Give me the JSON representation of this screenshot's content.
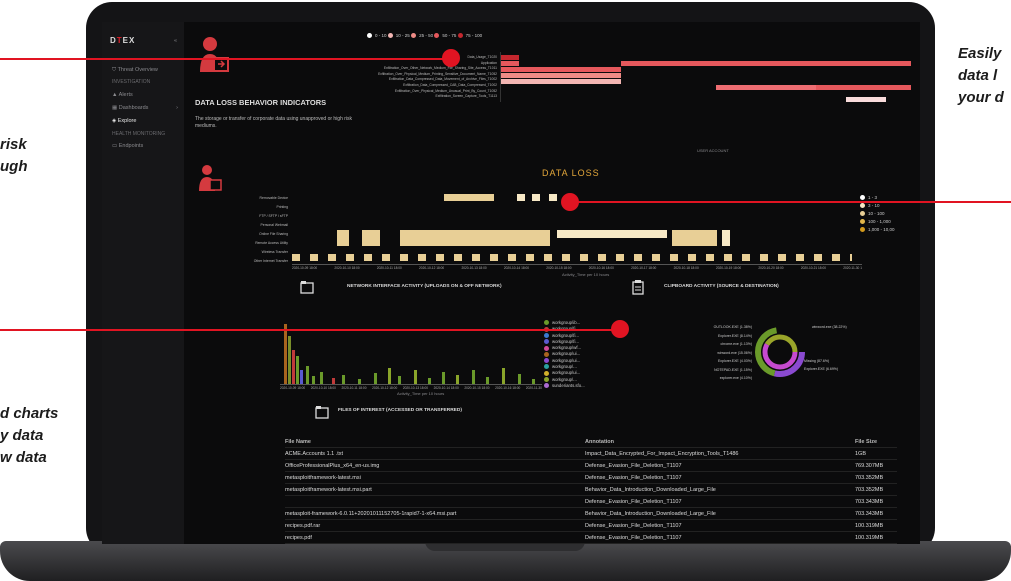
{
  "callouts": {
    "top_right": [
      "Easily",
      "data l",
      "your d"
    ],
    "mid_left": [
      "risk",
      "ugh"
    ],
    "bottom_left": [
      "d charts",
      "y data",
      "w data"
    ]
  },
  "sidebar": {
    "logo_pre": "D",
    "logo_accent": "T",
    "logo_post": "EX",
    "collapse": "«",
    "items": [
      {
        "label": "Threat Overview",
        "icon": "shield-icon"
      },
      {
        "label": "Alerts",
        "icon": "warning-icon"
      },
      {
        "label": "Dashboards",
        "icon": "grid-icon",
        "chevron": "›"
      },
      {
        "label": "Explore",
        "icon": "explore-icon"
      },
      {
        "label": "Endpoints",
        "icon": "monitor-icon"
      }
    ],
    "headers": [
      "INVESTIGATION",
      "HEALTH MONITORING"
    ]
  },
  "behavior": {
    "title": "DATA LOSS BEHAVIOR INDICATORS",
    "description": "The storage or transfer of corporate data using unapproved or high risk mediums.",
    "legend": [
      "0 - 10",
      "10 - 25",
      "25 - 50",
      "50 - 75",
      "75 - 100"
    ],
    "legend_colors": [
      "#ffffff",
      "#f3b6b3",
      "#ee8b86",
      "#e5585c",
      "#c4272e"
    ],
    "row_labels": [
      "Data_Usage_T1020",
      "Application",
      "Exfiltration_Over_Other_Network_Medium_File_Sharing_Site_Access_T1011",
      "Exfiltration_Over_Physical_Medium_Printing_Sensitive_Document_Name_T1052",
      "Exfiltration_Data_Compressed_Data_Movement_of_Archive_Files_T1002",
      "Exfiltration_Data_Compressed_CAB_Data_Compressed_T1002",
      "Exfiltration_Over_Physical_Medium_Unusual_Print_By_Count_T1052",
      "Exfiltration_Screen_Capture_Tools_T1113"
    ],
    "y_axis_label": "DATA LOSS BEHAVIOR INDICATORS",
    "x_axis_label": "USER ACCOUNT"
  },
  "dataloss": {
    "title": "DATA LOSS",
    "row_labels": [
      "Removable Device",
      "Printing",
      "FTP / SFTP / sFTP",
      "Personal Webmail",
      "Online File Sharing",
      "Remote Access Utility",
      "Wireless Transfer",
      "Other Internet Transfer"
    ],
    "x_ticks": [
      "2020-10-09 18:00",
      "2020-10-10 18:00",
      "2020-10-11 18:00",
      "2020-10-12 18:00",
      "2020-10-13 18:00",
      "2020-10-14 18:00",
      "2020-10-15 18:00",
      "2020-10-16 18:00",
      "2020-10-17 18:00",
      "2020-10-18 18:00",
      "2020-10-19 18:00",
      "2020-10-20 18:00",
      "2020-10-21 18:00",
      "2020-11-30 1"
    ],
    "x_label": "Activity_Time per 10 hours",
    "y_label": "Class",
    "legend": [
      "1 - 3",
      "3 - 10",
      "10 - 100",
      "100 - 1,000",
      "1,000 - 10,00"
    ]
  },
  "network": {
    "title": "NETWORK INTERFACE ACTIVITY (UPLOADS ON & OFF NETWORK)",
    "x_ticks": [
      "2020-10-09 18:00",
      "2020-10-10 18:00",
      "2020-10-11 18:00",
      "2020-10-12 18:00",
      "2020-10-13 18:00",
      "2020-10-14 18:00",
      "2020-10-15 18:00",
      "2020-10-16 18:00",
      "2020-11-30"
    ],
    "x_label": "Activity_Time per 10 hours",
    "legend": [
      "workgroup\\ib...",
      "workgroup\\fi...",
      "workgroup\\fi...",
      "workgroup\\fi...",
      "workgroup\\wf...",
      "workgroup\\ui...",
      "workgroup\\ui...",
      "workgroup\\...",
      "workgroup\\ui...",
      "workgroup\\...",
      "sunderiants.sfo..."
    ]
  },
  "clipboard": {
    "title": "CLIPBOARD ACTIVITY (SOURCE & DESTINATION)",
    "left_labels": [
      "OUTLOOK.EXE (1.38%)",
      "Explorer.EXE (8.14%)",
      "chrome.exe (1.13%)",
      "winword.exe (15.06%)",
      "Explorer.EXE (4.03%)",
      "NOTEPAD.EXE (1.15%)",
      "explorer.exe (4.10%)"
    ],
    "right_labels": [
      "winword.exe (38.22%)",
      "Missing (87.6%)",
      "Explorer.EXE (6.69%)"
    ]
  },
  "files": {
    "title": "FILES OF INTEREST (ACCESSED OR TRANSFERRED)",
    "headers": [
      "File Name",
      "Annotation",
      "File Size"
    ],
    "rows": [
      [
        "ACME.Accounts 1.1 .txt",
        "Impact_Data_Encrypted_For_Impact_Encryption_Tools_T1486",
        "1GB"
      ],
      [
        "OfficeProfessionalPlus_x64_en-us.img",
        "Defense_Evasion_File_Deletion_T1107",
        "769.307MB"
      ],
      [
        "metasploitframework-latest.msi",
        "Defense_Evasion_File_Deletion_T1107",
        "703.352MB"
      ],
      [
        "metasploitframework-latest.msi.part",
        "Behavior_Data_Introduction_Downloaded_Large_File",
        "703.352MB"
      ],
      [
        "",
        "Defense_Evasion_File_Deletion_T1107",
        "703.343MB"
      ],
      [
        "metasploit-framework-6.0.11+20201011152705-1rapid7-1-x64.msi.part",
        "Behavior_Data_Introduction_Downloaded_Large_File",
        "703.343MB"
      ],
      [
        "recipes.pdf.rar",
        "Defense_Evasion_File_Deletion_T1107",
        "100.319MB"
      ],
      [
        "recipes.pdf",
        "Defense_Evasion_File_Deletion_T1107",
        "100.319MB"
      ]
    ]
  }
}
